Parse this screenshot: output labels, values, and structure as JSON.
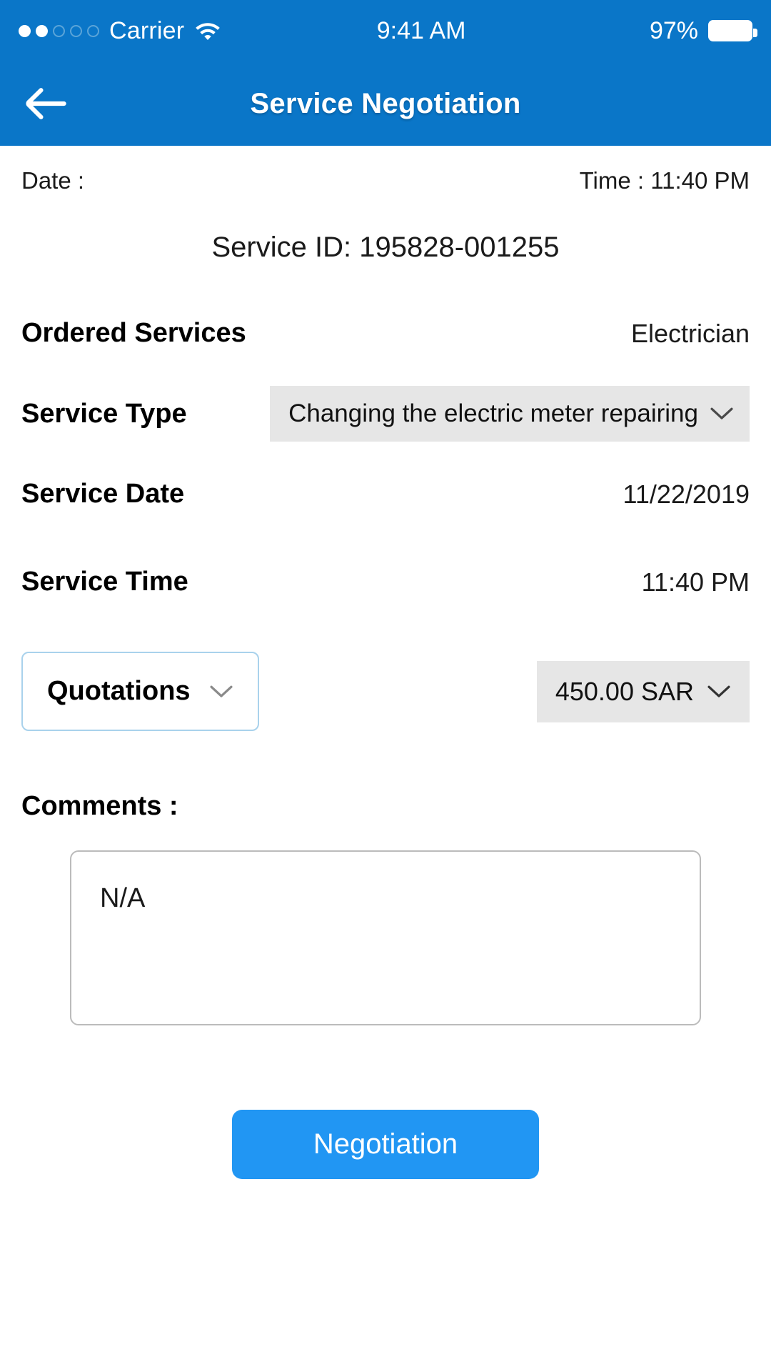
{
  "status_bar": {
    "carrier": "Carrier",
    "signal_dots_filled": 2,
    "signal_dots_total": 5,
    "wifi_icon": "wifi-icon",
    "time": "9:41 AM",
    "battery_percent": "97%",
    "battery_icon": "battery-full-icon"
  },
  "nav": {
    "back_icon": "arrow-left-icon",
    "title": "Service Negotiation"
  },
  "meta": {
    "date_label": "Date :",
    "time_label": "Time : 11:40 PM",
    "service_id": "Service ID: 195828-001255"
  },
  "fields": {
    "ordered_services": {
      "label": "Ordered Services",
      "value": "Electrician"
    },
    "service_type": {
      "label": "Service Type",
      "value": "Changing the electric meter repairing",
      "chevron_icon": "chevron-down-icon"
    },
    "service_date": {
      "label": "Service Date",
      "value": "11/22/2019"
    },
    "service_time": {
      "label": "Service Time",
      "value": "11:40 PM"
    }
  },
  "quotations": {
    "label": "Quotations",
    "chevron_icon": "chevron-down-icon",
    "price": "450.00 SAR",
    "price_chevron_icon": "chevron-down-icon"
  },
  "comments": {
    "label": "Comments :",
    "value": "N/A",
    "placeholder": "N/A"
  },
  "actions": {
    "negotiation_label": "Negotiation"
  },
  "colors": {
    "header_blue": "#0a76c8",
    "button_blue": "#2196f3",
    "select_grey": "#e6e6e6",
    "quote_border_blue": "#a9d2ec",
    "comments_border": "#bbbbbb"
  }
}
